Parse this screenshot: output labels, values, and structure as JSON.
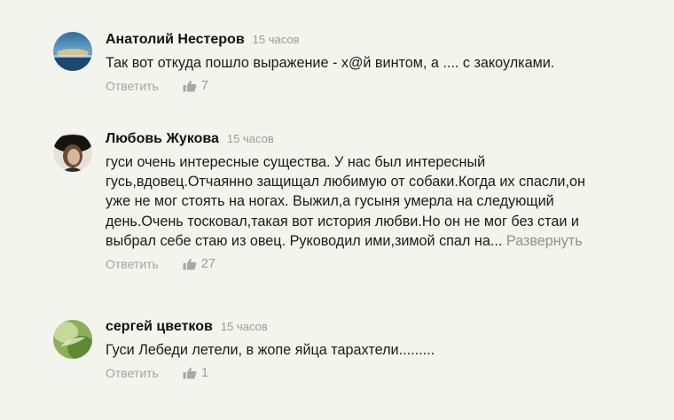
{
  "comments": [
    {
      "author": "Анатолий Нестеров",
      "time": "15 часов",
      "lines": [
        "Так вот откуда пошло выражение - х@й винтом, а .... с закоулками."
      ],
      "reply_label": "Ответить",
      "likes": "7",
      "avatar_icon": "landscape-photo"
    },
    {
      "author": "Любовь Жукова",
      "time": "15 часов",
      "lines": [
        "гуси очень интересные существа. У нас был интересный",
        "гусь,вдовец.Отчаянно защищал любимую от собаки.Когда их спасли,он",
        "уже не мог стоять на ногах. Выжил,а гусыня умерла на следующий",
        "день.Очень тосковал,такая вот история любви.Но он не мог без стаи и",
        "выбрал себе стаю из овец. Руководил ими,зимой спал на..."
      ],
      "expand_label": "Развернуть",
      "reply_label": "Ответить",
      "likes": "27",
      "avatar_icon": "woman-hat-photo"
    },
    {
      "author": "сергей цветков",
      "time": "15 часов",
      "lines": [
        "Гуси Лебеди летели, в жопе яйца тарахтели........."
      ],
      "reply_label": "Ответить",
      "likes": "1",
      "avatar_icon": "nature-photo"
    }
  ],
  "colors": {
    "background": "#f4f4ef",
    "author": "#111111",
    "meta": "#9a9a9a"
  }
}
